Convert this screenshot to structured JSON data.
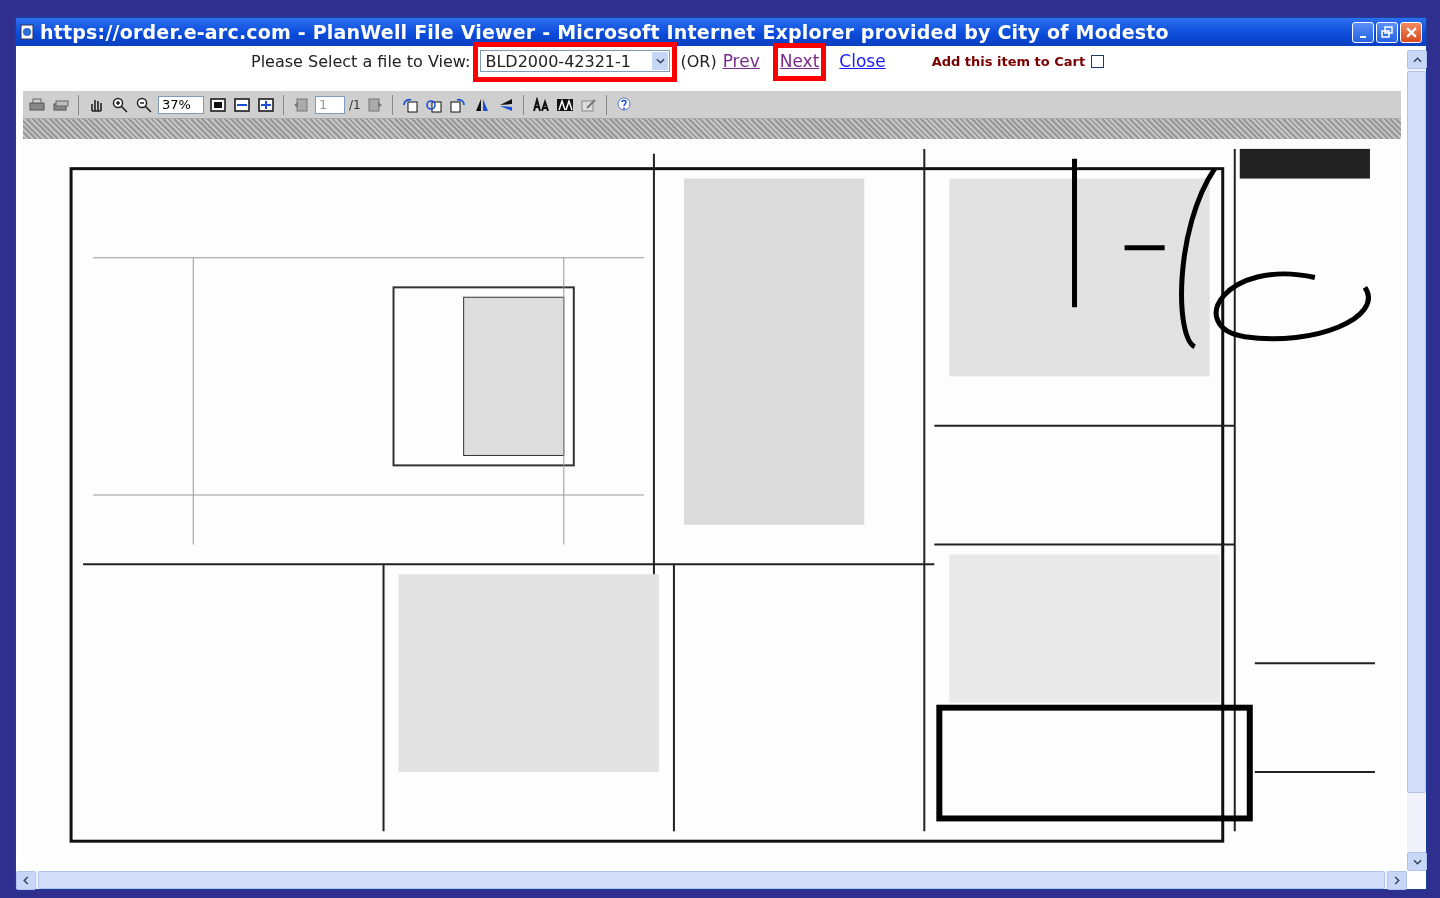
{
  "window": {
    "title": "https://order.e-arc.com - PlanWell File Viewer - Microsoft Internet Explorer provided by City of Modesto"
  },
  "file_select": {
    "label": "Please Select a file to View:",
    "value": "BLD2000-42321-1",
    "highlighted": true
  },
  "or_label": "(OR)",
  "nav_links": [
    {
      "text": "Prev",
      "visited": true,
      "highlighted": false
    },
    {
      "text": "Next",
      "visited": true,
      "highlighted": true
    },
    {
      "text": "Close",
      "visited": false,
      "highlighted": false
    }
  ],
  "cart": {
    "label": "Add this item to Cart",
    "checked": false
  },
  "toolbar": {
    "zoom": "37%",
    "page": "1",
    "page_count": "/1"
  }
}
